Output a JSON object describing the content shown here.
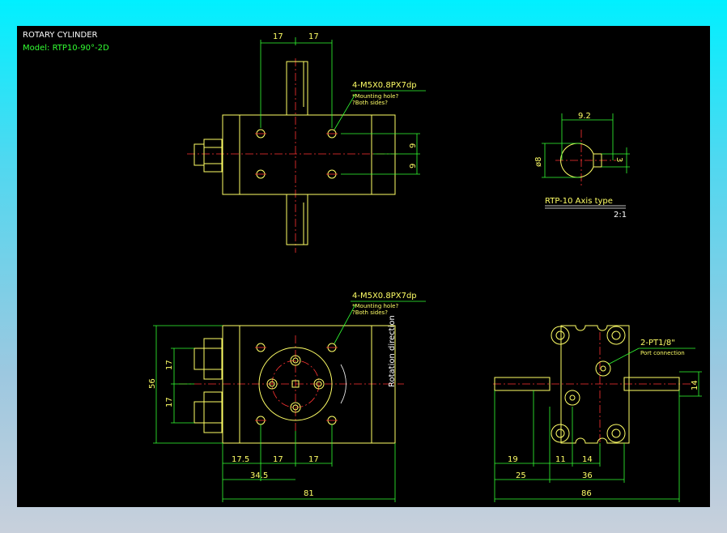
{
  "title": "ROTARY CYLINDER",
  "model": "Model: RTP10-90°-2D",
  "top_view": {
    "dim_left": "17",
    "dim_right": "17",
    "dim_v1": "9",
    "dim_v2": "9",
    "callout": "4-M5X0.8PX7dp",
    "note1": "*Mounting hole?",
    "note2": "?Both sides?"
  },
  "axis_view": {
    "dim_width": "9.2",
    "dim_dia": "ø8",
    "dim_key": "3",
    "label": "RTP-10 Axis type",
    "scale": "2:1"
  },
  "front_view": {
    "callout": "4-M5X0.8PX7dp",
    "note1": "*Mounting hole?",
    "note2": "?Both sides?",
    "dim_height": "56",
    "dim_upper": "17",
    "dim_lower": "17",
    "rotation_label": "Rotation direction",
    "dim_b1": "17.5",
    "dim_b2": "17",
    "dim_b3": "17",
    "dim_b4": "34.5",
    "dim_b5": "81"
  },
  "side_view": {
    "port_callout": "2-PT1/8\"",
    "port_note": "Port connection",
    "dim_right": "14",
    "dim_b1": "19",
    "dim_b2": "11",
    "dim_b3": "14",
    "dim_b4": "25",
    "dim_b5": "36",
    "dim_b6": "86"
  }
}
